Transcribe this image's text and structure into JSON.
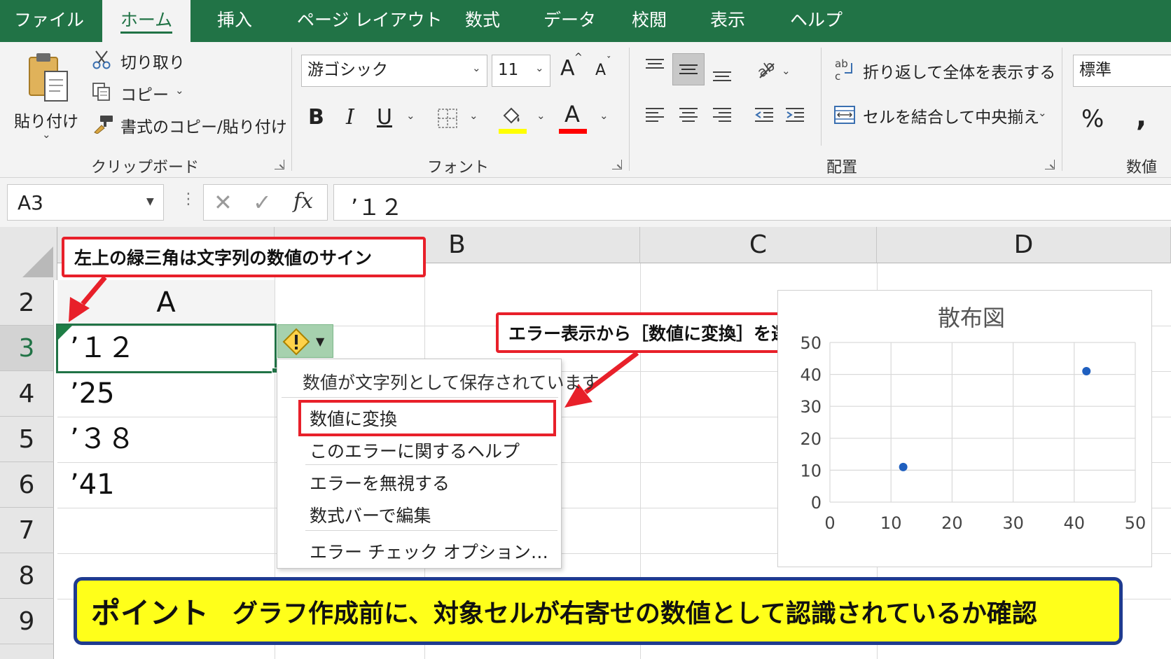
{
  "tabs": [
    {
      "label": "ファイル",
      "active": false
    },
    {
      "label": "ホーム",
      "active": true
    },
    {
      "label": "挿入",
      "active": false
    },
    {
      "label": "ページ レイアウト",
      "active": false
    },
    {
      "label": "数式",
      "active": false
    },
    {
      "label": "データ",
      "active": false
    },
    {
      "label": "校閲",
      "active": false
    },
    {
      "label": "表示",
      "active": false
    },
    {
      "label": "ヘルプ",
      "active": false
    }
  ],
  "clipboard": {
    "paste_label": "貼り付け",
    "cut_label": "切り取り",
    "copy_label": "コピー",
    "format_painter_label": "書式のコピー/貼り付け",
    "group_label": "クリップボード"
  },
  "font": {
    "font_name": "游ゴシック",
    "font_size": "11",
    "grow_label": "A",
    "shrink_label": "A",
    "bold_label": "B",
    "italic_label": "I",
    "underline_label": "U",
    "font_color_label": "A",
    "highlight_color": "#ffff00",
    "font_color": "#ff0000",
    "group_label": "フォント"
  },
  "alignment": {
    "wrap_text_label": "折り返して全体を表示する",
    "merge_center_label": "セルを結合して中央揃え",
    "group_label": "配置"
  },
  "number": {
    "format_value": "標準",
    "percent_label": "%",
    "comma_label": ",",
    "group_label": "数値"
  },
  "formula_bar": {
    "name_box": "A3",
    "fx_label": "fx",
    "content": "’１２"
  },
  "grid": {
    "columns": [
      "B",
      "C",
      "D"
    ],
    "rows": [
      "2",
      "3",
      "4",
      "5",
      "6",
      "7",
      "8",
      "9"
    ],
    "cells": {
      "a2": "A",
      "a3": "’１２",
      "a4": "’25",
      "a5": "’３８",
      "a6": "’41"
    }
  },
  "callouts": {
    "green_triangle_note": "左上の緑三角は文字列の数値のサイン",
    "convert_note": "エラー表示から［数値に変換］を選択"
  },
  "error_menu": {
    "header": "数値が文字列として保存されています",
    "items": [
      "数値に変換",
      "このエラーに関するヘルプ",
      "エラーを無視する",
      "数式バーで編集",
      "エラー チェック オプション…"
    ]
  },
  "chart_data": {
    "type": "scatter",
    "title": "散布図",
    "xlabel": "",
    "ylabel": "",
    "xlim": [
      0,
      50
    ],
    "ylim": [
      0,
      50
    ],
    "x_ticks": [
      "0",
      "10",
      "20",
      "30",
      "40",
      "50"
    ],
    "y_ticks": [
      "0",
      "10",
      "20",
      "30",
      "40",
      "50"
    ],
    "grid": true,
    "points": [
      {
        "x": 12,
        "y": 11
      },
      {
        "x": 42,
        "y": 41
      }
    ],
    "marker_color": "#1f5fbf"
  },
  "banner": {
    "lead": "ポイント",
    "text": "グラフ作成前に、対象セルが右寄せの数値として認識されているか確認"
  },
  "colors": {
    "excel_green": "#217346",
    "callout_red": "#e8202a",
    "banner_yellow": "#ffff1a",
    "banner_border": "#1f3b8f"
  }
}
